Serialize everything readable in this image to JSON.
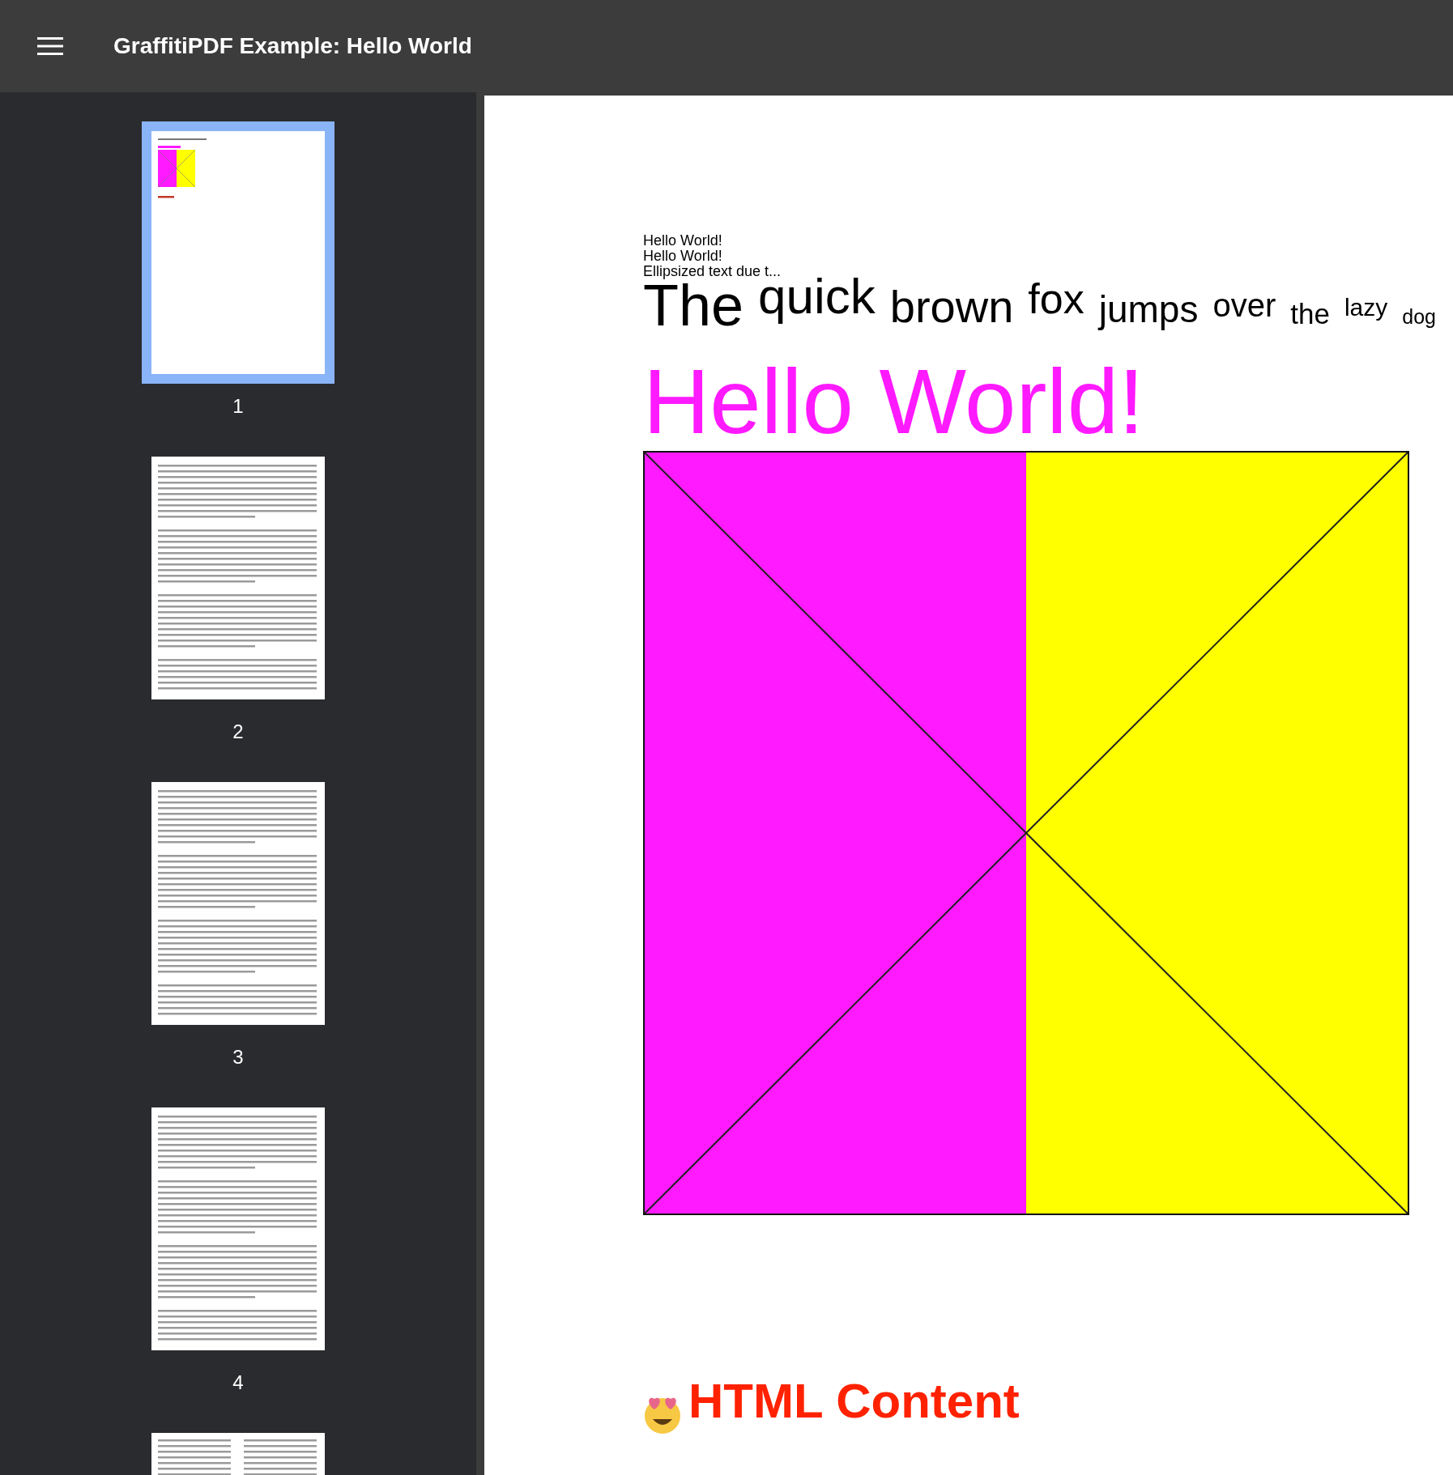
{
  "app_bar": {
    "title": "GraffitiPDF Example: Hello World"
  },
  "thumbnails": [
    {
      "label": "1",
      "selected": true,
      "kind": "cover"
    },
    {
      "label": "2",
      "selected": false,
      "kind": "text"
    },
    {
      "label": "3",
      "selected": false,
      "kind": "text"
    },
    {
      "label": "4",
      "selected": false,
      "kind": "text"
    },
    {
      "selected": false,
      "kind": "two_column"
    }
  ],
  "page": {
    "lines": [
      "Hello World!",
      "Hello World!",
      "Ellipsized text due t..."
    ],
    "words": [
      "The",
      "quick",
      "brown",
      "fox",
      "jumps",
      "over",
      "the",
      "lazy",
      "dog"
    ],
    "heading": "Hello World!",
    "html_heading": "HTML Content"
  }
}
